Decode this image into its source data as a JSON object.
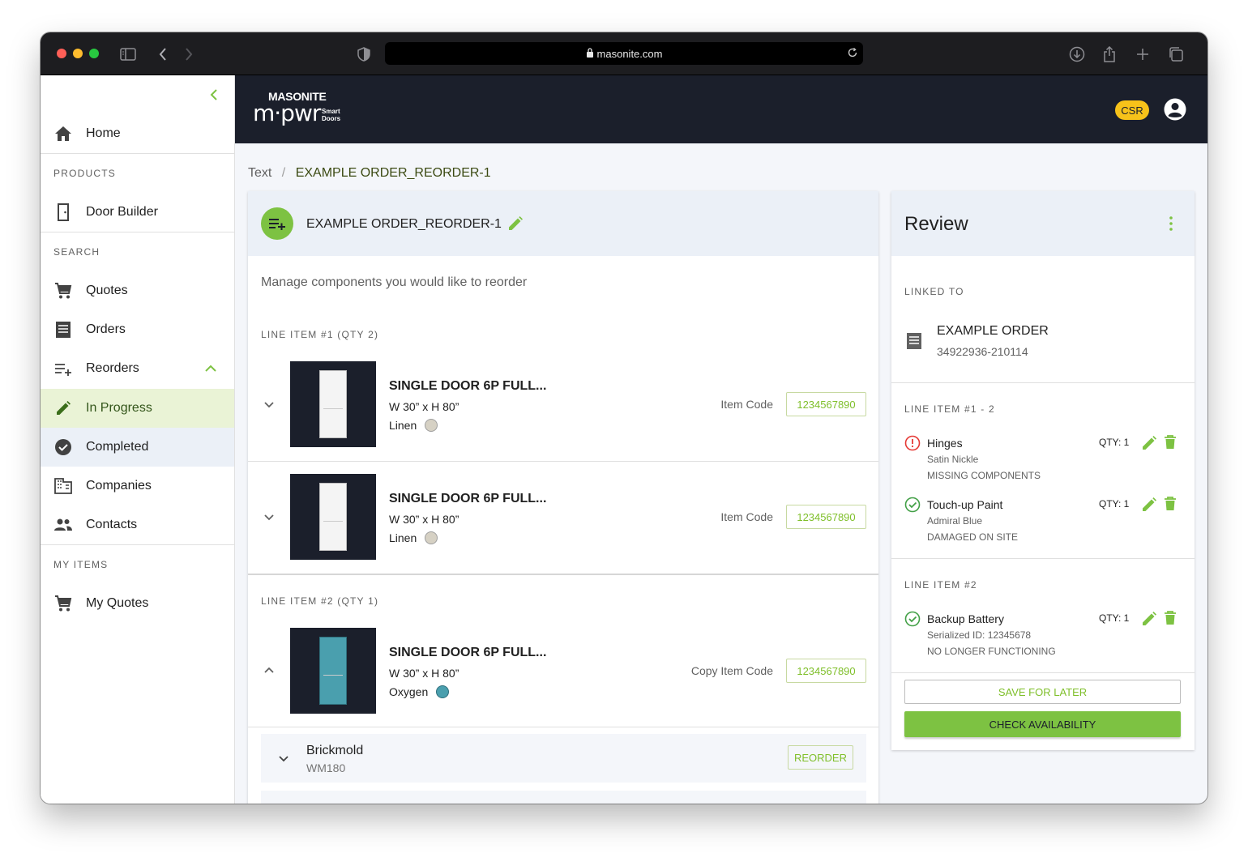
{
  "browser": {
    "url": "masonite.com"
  },
  "sidebar": {
    "home": "Home",
    "products_header": "PRODUCTS",
    "door_builder": "Door Builder",
    "search_header": "SEARCH",
    "quotes": "Quotes",
    "orders": "Orders",
    "reorders": "Reorders",
    "in_progress": "In Progress",
    "completed": "Completed",
    "companies": "Companies",
    "contacts": "Contacts",
    "my_items_header": "MY ITEMS",
    "my_quotes": "My Quotes"
  },
  "header": {
    "brand_top": "MASONITE",
    "brand_main": "m·pwr",
    "brand_sub1": "Smart",
    "brand_sub2": "Doors",
    "role_badge": "CSR"
  },
  "breadcrumb": {
    "root": "Text",
    "sep": "/",
    "current": "EXAMPLE ORDER_REORDER-1"
  },
  "order": {
    "title": "EXAMPLE ORDER_REORDER-1",
    "description": "Manage components you would like to reorder",
    "line1_label": "LINE ITEM #1 (QTY 2)",
    "line2_label": "LINE ITEM #2 (QTY 1)",
    "rows": [
      {
        "title": "SINGLE DOOR 6P FULL...",
        "dims": "W 30” x H 80”",
        "color": "Linen",
        "code_label": "Item Code",
        "code": "1234567890"
      },
      {
        "title": "SINGLE DOOR 6P FULL...",
        "dims": "W 30” x H 80”",
        "color": "Linen",
        "code_label": "Item Code",
        "code": "1234567890"
      },
      {
        "title": "SINGLE DOOR 6P FULL...",
        "dims": "W 30” x H 80”",
        "color": "Oxygen",
        "code_label": "Copy Item Code",
        "code": "1234567890"
      }
    ],
    "component": {
      "name": "Brickmold",
      "code": "WM180",
      "button": "REORDER"
    }
  },
  "review": {
    "title": "Review",
    "linked_label": "LINKED TO",
    "linked_name": "EXAMPLE ORDER",
    "linked_number": "34922936-210114",
    "group1_label": "LINE ITEM #1 - 2",
    "group2_label": "LINE ITEM #2",
    "items": [
      {
        "name": "Hinges",
        "detail": "Satin Nickle",
        "reason": "MISSING COMPONENTS",
        "qty": "QTY: 1"
      },
      {
        "name": "Touch-up Paint",
        "detail": "Admiral Blue",
        "reason": "DAMAGED ON SITE",
        "qty": "QTY: 1"
      },
      {
        "name": "Backup Battery",
        "detail": "Serialized ID: 12345678",
        "reason": "NO LONGER FUNCTIONING",
        "qty": "QTY: 1"
      }
    ],
    "save_button": "SAVE FOR LATER",
    "check_button": "CHECK AVAILABILITY"
  },
  "colors": {
    "accent": "#7dc242",
    "header": "#1b1f2b",
    "linen": "#d6d1c4",
    "oxygen": "#4a9fae",
    "error": "#e53935",
    "badge": "#f7c21a"
  }
}
